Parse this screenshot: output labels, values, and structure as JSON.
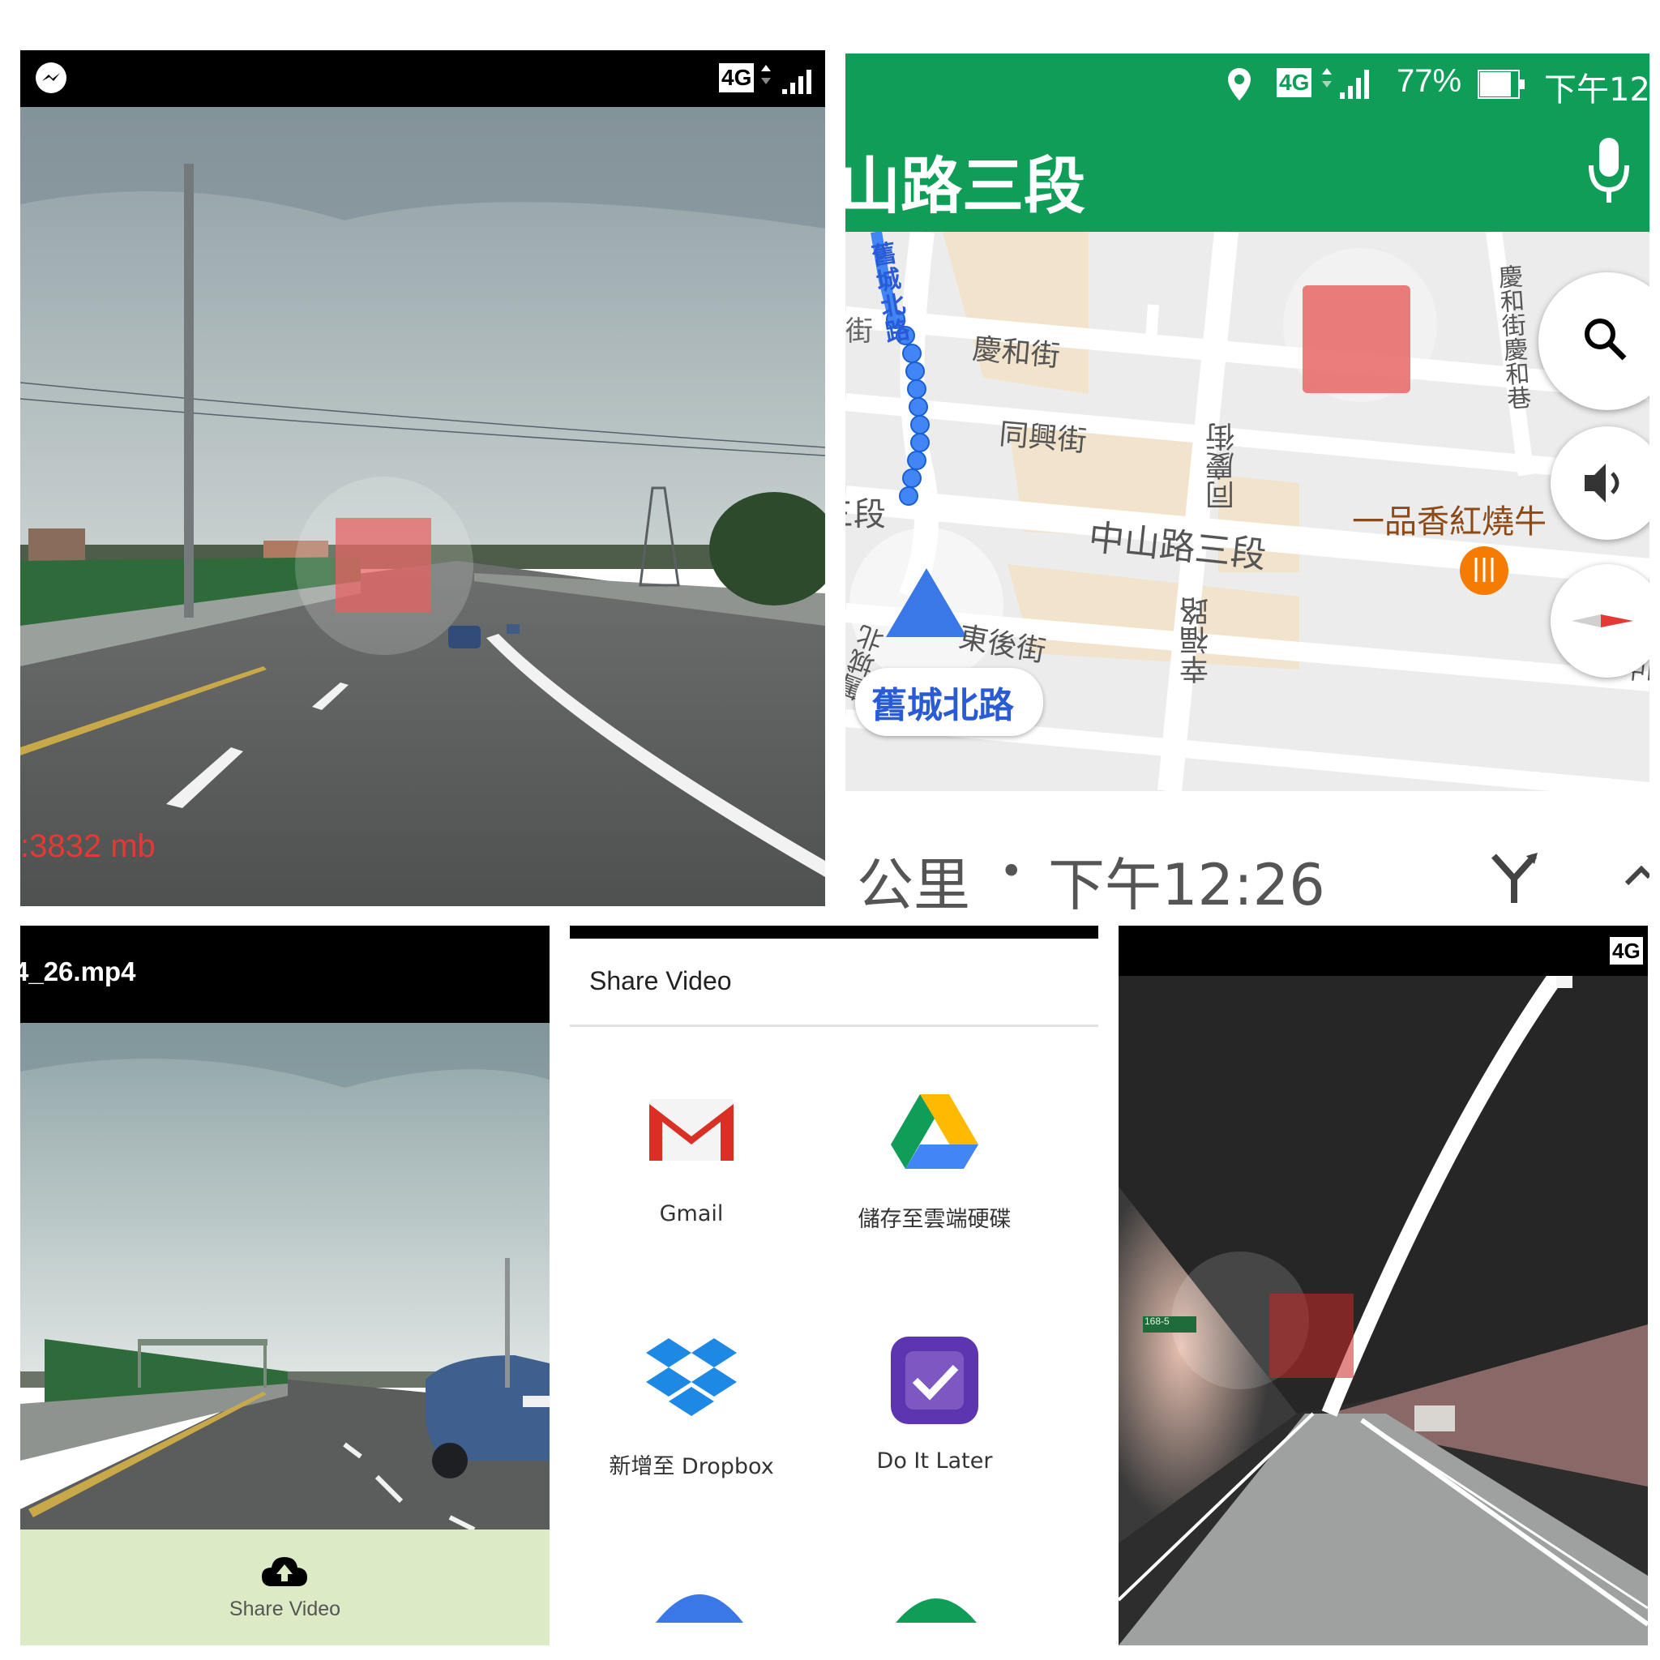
{
  "dashcam": {
    "storage_text": ":3832 mb",
    "network": "4G"
  },
  "maps": {
    "status": {
      "network": "4G",
      "battery": "77%",
      "time": "下午12"
    },
    "street_header": "山路三段",
    "map_labels": {
      "jiucheng_vertical": "舊城北路",
      "qinghe_street": "慶和街",
      "tongxing_street": "同興街",
      "tongqing_street": "同慶街",
      "duan_left": "三段",
      "zhongshan_road": "中山路三段",
      "xingfu_road": "幸福路",
      "dong_hou_street": "東後街",
      "qinghe_lane": "慶和街慶和巷",
      "restaurant": "一品香紅燒牛",
      "zhong_right": "中山",
      "jiucheng_bottom": "舊城北",
      "left_edge": "街"
    },
    "current_road_chip": "舊城北路",
    "eta": {
      "distance_unit": "公里",
      "separator": "•",
      "arrival": "下午12:26"
    }
  },
  "player": {
    "filename": "4_26.mp4",
    "share_label": "Share Video"
  },
  "share_dialog": {
    "title": "Share Video",
    "apps": [
      {
        "label": "Gmail",
        "icon": "gmail-icon"
      },
      {
        "label": "儲存至雲端硬碟",
        "icon": "google-drive-icon"
      },
      {
        "label": "新增至 Dropbox",
        "icon": "dropbox-icon"
      },
      {
        "label": "Do It Later",
        "icon": "do-it-later-icon"
      }
    ]
  },
  "tunnel": {
    "network": "4G",
    "sign_text": "168-5"
  },
  "colors": {
    "maps_green": "#0f9d58",
    "nav_blue": "#4285f4",
    "overlay_red": "#e86060",
    "storage_red": "#e53935",
    "share_bar": "#dcebc6"
  }
}
